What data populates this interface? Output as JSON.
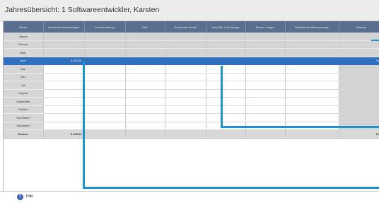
{
  "window": {
    "title": "Jahresübersicht: 1  Softwareentwickler, Karsten"
  },
  "table": {
    "columns": [
      "Monat",
      "Laufendes Arbeitsentgelt",
      "Einmal zahlung",
      "VWL",
      "Geldwerter Vorteil",
      "Netto Be- und Abzüge",
      "Steuer- magen",
      "Betriebliche Altersvorsorge",
      "Summe"
    ],
    "rows": [
      {
        "month": "Januar",
        "cells": [
          "",
          "",
          "",
          "",
          "",
          "",
          "",
          ""
        ]
      },
      {
        "month": "Februar",
        "cells": [
          "",
          "",
          "",
          "",
          "",
          "",
          "",
          ""
        ]
      },
      {
        "month": "März",
        "cells": [
          "",
          "",
          "",
          "",
          "",
          "",
          "",
          ""
        ]
      },
      {
        "month": "April",
        "cells": [
          "3.000,00",
          "",
          "",
          "",
          "",
          "",
          "",
          "3.00"
        ]
      },
      {
        "month": "Mai",
        "cells": [
          "",
          "",
          "",
          "",
          "",
          "",
          "",
          ""
        ]
      },
      {
        "month": "Juni",
        "cells": [
          "",
          "",
          "",
          "",
          "",
          "",
          "",
          ""
        ]
      },
      {
        "month": "Juli",
        "cells": [
          "",
          "",
          "",
          "",
          "",
          "",
          "",
          ""
        ]
      },
      {
        "month": "August",
        "cells": [
          "",
          "",
          "",
          "",
          "",
          "",
          "",
          ""
        ]
      },
      {
        "month": "September",
        "cells": [
          "",
          "",
          "",
          "",
          "",
          "",
          "",
          ""
        ]
      },
      {
        "month": "Oktober",
        "cells": [
          "",
          "",
          "",
          "",
          "",
          "",
          "",
          ""
        ]
      },
      {
        "month": "November",
        "cells": [
          "",
          "",
          "",
          "",
          "",
          "",
          "",
          ""
        ]
      },
      {
        "month": "Dezember",
        "cells": [
          "",
          "",
          "",
          "",
          "",
          "",
          "",
          ""
        ]
      }
    ],
    "total": {
      "label": "Summe",
      "cells": [
        "3.000,00",
        "",
        "",
        "",
        "",
        "",
        "",
        "3.00"
      ]
    }
  },
  "footer": {
    "help_label": "Hilfe",
    "help_icon": "help-icon"
  },
  "colors": {
    "header": "#5a6f8f",
    "selected": "#2f6fbd",
    "callout": "#1f93cf"
  }
}
